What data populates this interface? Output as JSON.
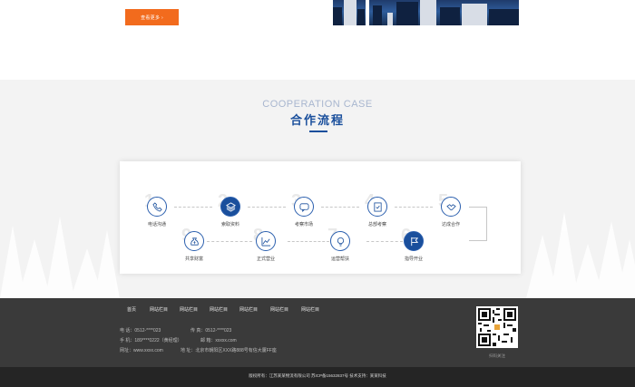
{
  "top": {
    "more_button": "查看更多 ›"
  },
  "coop": {
    "title_en": "COOPERATION CASE",
    "title_cn": "合作流程",
    "steps": [
      {
        "num": "1",
        "label": "电话沟通",
        "icon": "phone-icon"
      },
      {
        "num": "2",
        "label": "索取资料",
        "icon": "layers-icon"
      },
      {
        "num": "3",
        "label": "考察市场",
        "icon": "chat-icon"
      },
      {
        "num": "4",
        "label": "总部考察",
        "icon": "checklist-icon"
      },
      {
        "num": "5",
        "label": "达成合作",
        "icon": "handshake-icon"
      },
      {
        "num": "6",
        "label": "指导开业",
        "icon": "flag-icon"
      },
      {
        "num": "7",
        "label": "运营帮扶",
        "icon": "bulb-icon"
      },
      {
        "num": "8",
        "label": "正式营业",
        "icon": "chart-icon"
      },
      {
        "num": "9",
        "label": "共享财富",
        "icon": "money-bag-icon"
      }
    ]
  },
  "footer": {
    "nav": [
      "首页",
      "网站栏目",
      "网站栏目",
      "网站栏目",
      "网站栏目",
      "网站栏目",
      "网站栏目"
    ],
    "phone": "电  话：0512-****023",
    "fax": "传  真：0512-****023",
    "mobile": "手  机：189****0222（黄经理）",
    "email": "邮  箱：xxxxx.com",
    "website": "网址：www.xxxx.com",
    "address": "地  址：北京市朝阳区XXX路888号有信大厦FF座",
    "qr_label": "扫码关注",
    "copyright": "版权所有：江苏某某物流有限公司 苏ICP备15632837号 技术支持：某某科技"
  },
  "colors": {
    "accent": "#1a4f9c",
    "button": "#f26b1d",
    "footer_bg": "#3a3a3a",
    "bottom_bg": "#252525"
  }
}
